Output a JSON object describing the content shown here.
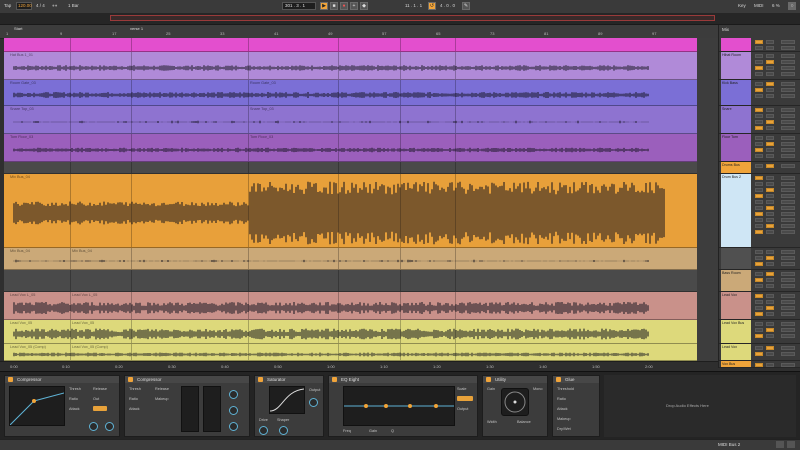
{
  "transport": {
    "tap_label": "Tap",
    "tempo": "120.00",
    "signature": "4 / 4",
    "metronome": "●●",
    "quantize": "1 Bar",
    "position": "301 . 3 . 1",
    "loop_start": "11 . 1 . 1",
    "loop_length": "4 . 0 . 0",
    "key_label": "Key",
    "midi_label": "MIDI",
    "cpu": "6 %",
    "link_label": "Link"
  },
  "ruler": {
    "markers": [
      "Start",
      "verse 1"
    ],
    "bars": [
      "1",
      "9",
      "17",
      "25",
      "33",
      "41",
      "49",
      "57",
      "65",
      "73",
      "81",
      "89",
      "97",
      "105"
    ],
    "times": [
      "0:00",
      "0:10",
      "0:20",
      "0:30",
      "0:40",
      "0:50",
      "1:00",
      "1:10",
      "1:20",
      "1:30",
      "1:40",
      "1:50",
      "2:00",
      "2:10"
    ]
  },
  "lanes": [
    {
      "label": "",
      "clips": []
    },
    {
      "label": "Hat Bus 1_01",
      "clips": [
        "Hat Bus 1_01"
      ]
    },
    {
      "label": "Kick Room Gate_03",
      "clips": [
        "Room Gate_03",
        "Room Gate_03"
      ]
    },
    {
      "label": "Snare Top_03",
      "clips": [
        "Snare Top_03",
        "Snare Top_03"
      ]
    },
    {
      "label": "Tom Floor_03",
      "clips": [
        "Tom Floor_03",
        "Tom Floor_03"
      ]
    },
    {
      "label": "",
      "clips": []
    },
    {
      "label": "Mix Bus_04",
      "clips": [
        "Mix Bus_04"
      ]
    },
    {
      "label": "Mix Bus_04",
      "clips": [
        "Mix Bus_04",
        "Mix Bus_04"
      ]
    },
    {
      "label": "",
      "clips": []
    },
    {
      "label": "Lead Vox L_05",
      "clips": [
        "Lead Vox L_05",
        "Lead Vox L_05"
      ]
    },
    {
      "label": "Lead Vox_05",
      "clips": [
        "Lead Vox_05",
        "Lead Vox_05"
      ]
    },
    {
      "label": "Lead Vox_05 (Comp)",
      "clips": [
        "Lead Vox_05 (Comp)",
        "Lead Vox_05 (Comp)"
      ]
    }
  ],
  "mixer": {
    "title": "Mix",
    "tracks": [
      "",
      "Hihat Room",
      "Kick Bass",
      "Snare",
      "Floor Tom",
      "Drums Bus",
      "Drum Bus 2",
      "",
      "Bass Room",
      "Lead Vox",
      "Lead Vox Bus",
      "Lead Vox",
      "Vox Bus"
    ]
  },
  "devices": [
    {
      "name": "Compressor",
      "labels": [
        "Thresh",
        "Ratio",
        "Attack",
        "Release",
        "Out",
        "Dry/Wet"
      ]
    },
    {
      "name": "Compressor",
      "labels": [
        "Thresh",
        "Ratio",
        "Attack",
        "Release",
        "Makeup",
        "Dry/Wet"
      ]
    },
    {
      "name": "Saturator",
      "labels": [
        "Drive",
        "Shaper",
        "Output",
        "Dry/Wet"
      ]
    },
    {
      "name": "EQ Eight",
      "labels": [
        "Freq",
        "Gain",
        "Q",
        "Scale",
        "Output"
      ]
    },
    {
      "name": "Utility",
      "labels": [
        "Gain",
        "Width",
        "Mono",
        "Balance"
      ]
    },
    {
      "name": "Glue",
      "labels": [
        "Threshold",
        "Ratio",
        "Attack",
        "Makeup",
        "Dry/Wet"
      ]
    }
  ],
  "drop_hint": "Drop Audio Effects Here",
  "status": {
    "track_name": "MIDI Bus 2"
  },
  "colors": {
    "magenta": "#e34fce",
    "violet": "#b08ad8",
    "indigo": "#7b6fd6",
    "lavender": "#8e73d0",
    "purple": "#9b5fbc",
    "orange": "#e8a03a",
    "tan": "#cba978",
    "rose": "#c9918a",
    "yellow": "#ddd97b",
    "accent": "#f0a43a"
  }
}
